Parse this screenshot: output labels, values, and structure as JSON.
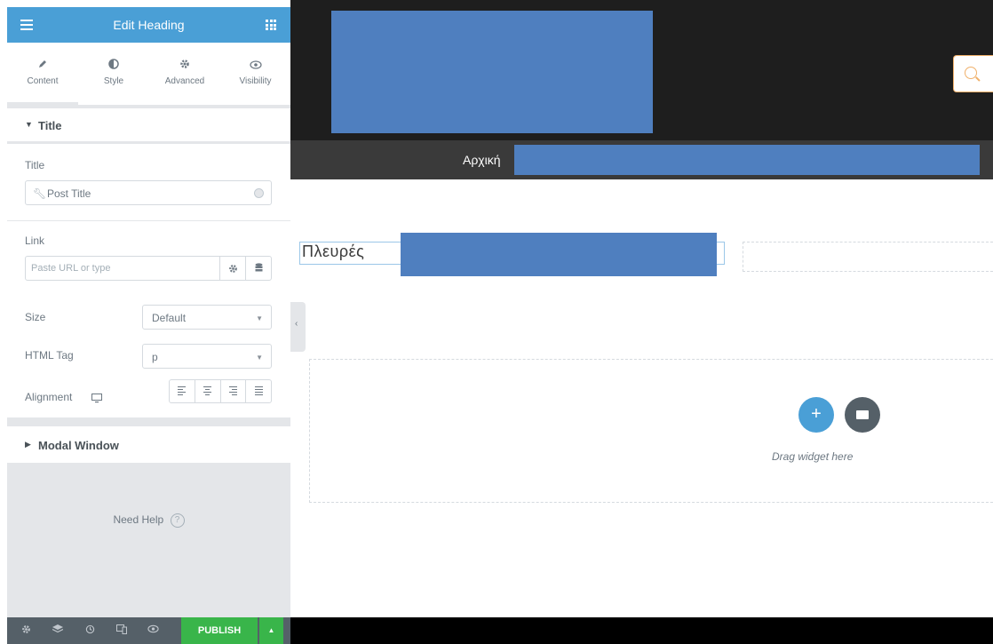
{
  "panel": {
    "header_title": "Edit Heading",
    "tabs": [
      {
        "label": "Content",
        "icon": "pencil-icon"
      },
      {
        "label": "Style",
        "icon": "half-circle-icon"
      },
      {
        "label": "Advanced",
        "icon": "gear-icon"
      },
      {
        "label": "Visibility",
        "icon": "eye-icon"
      }
    ],
    "title_section": {
      "heading": "Title",
      "title_label": "Title",
      "title_value": "Post Title",
      "link_label": "Link",
      "link_placeholder": "Paste URL or type",
      "size_label": "Size",
      "size_value": "Default",
      "html_tag_label": "HTML Tag",
      "html_tag_value": "p",
      "alignment_label": "Alignment"
    },
    "modal_section": {
      "heading": "Modal Window"
    },
    "need_help": "Need Help",
    "publish_label": "PUBLISH"
  },
  "preview": {
    "nav_home": "Αρχική",
    "heading_text": "Πλευρές",
    "drop_text": "Drag widget here",
    "accent_color": "#4a9fd6",
    "mask_color": "#4f7fbf"
  }
}
